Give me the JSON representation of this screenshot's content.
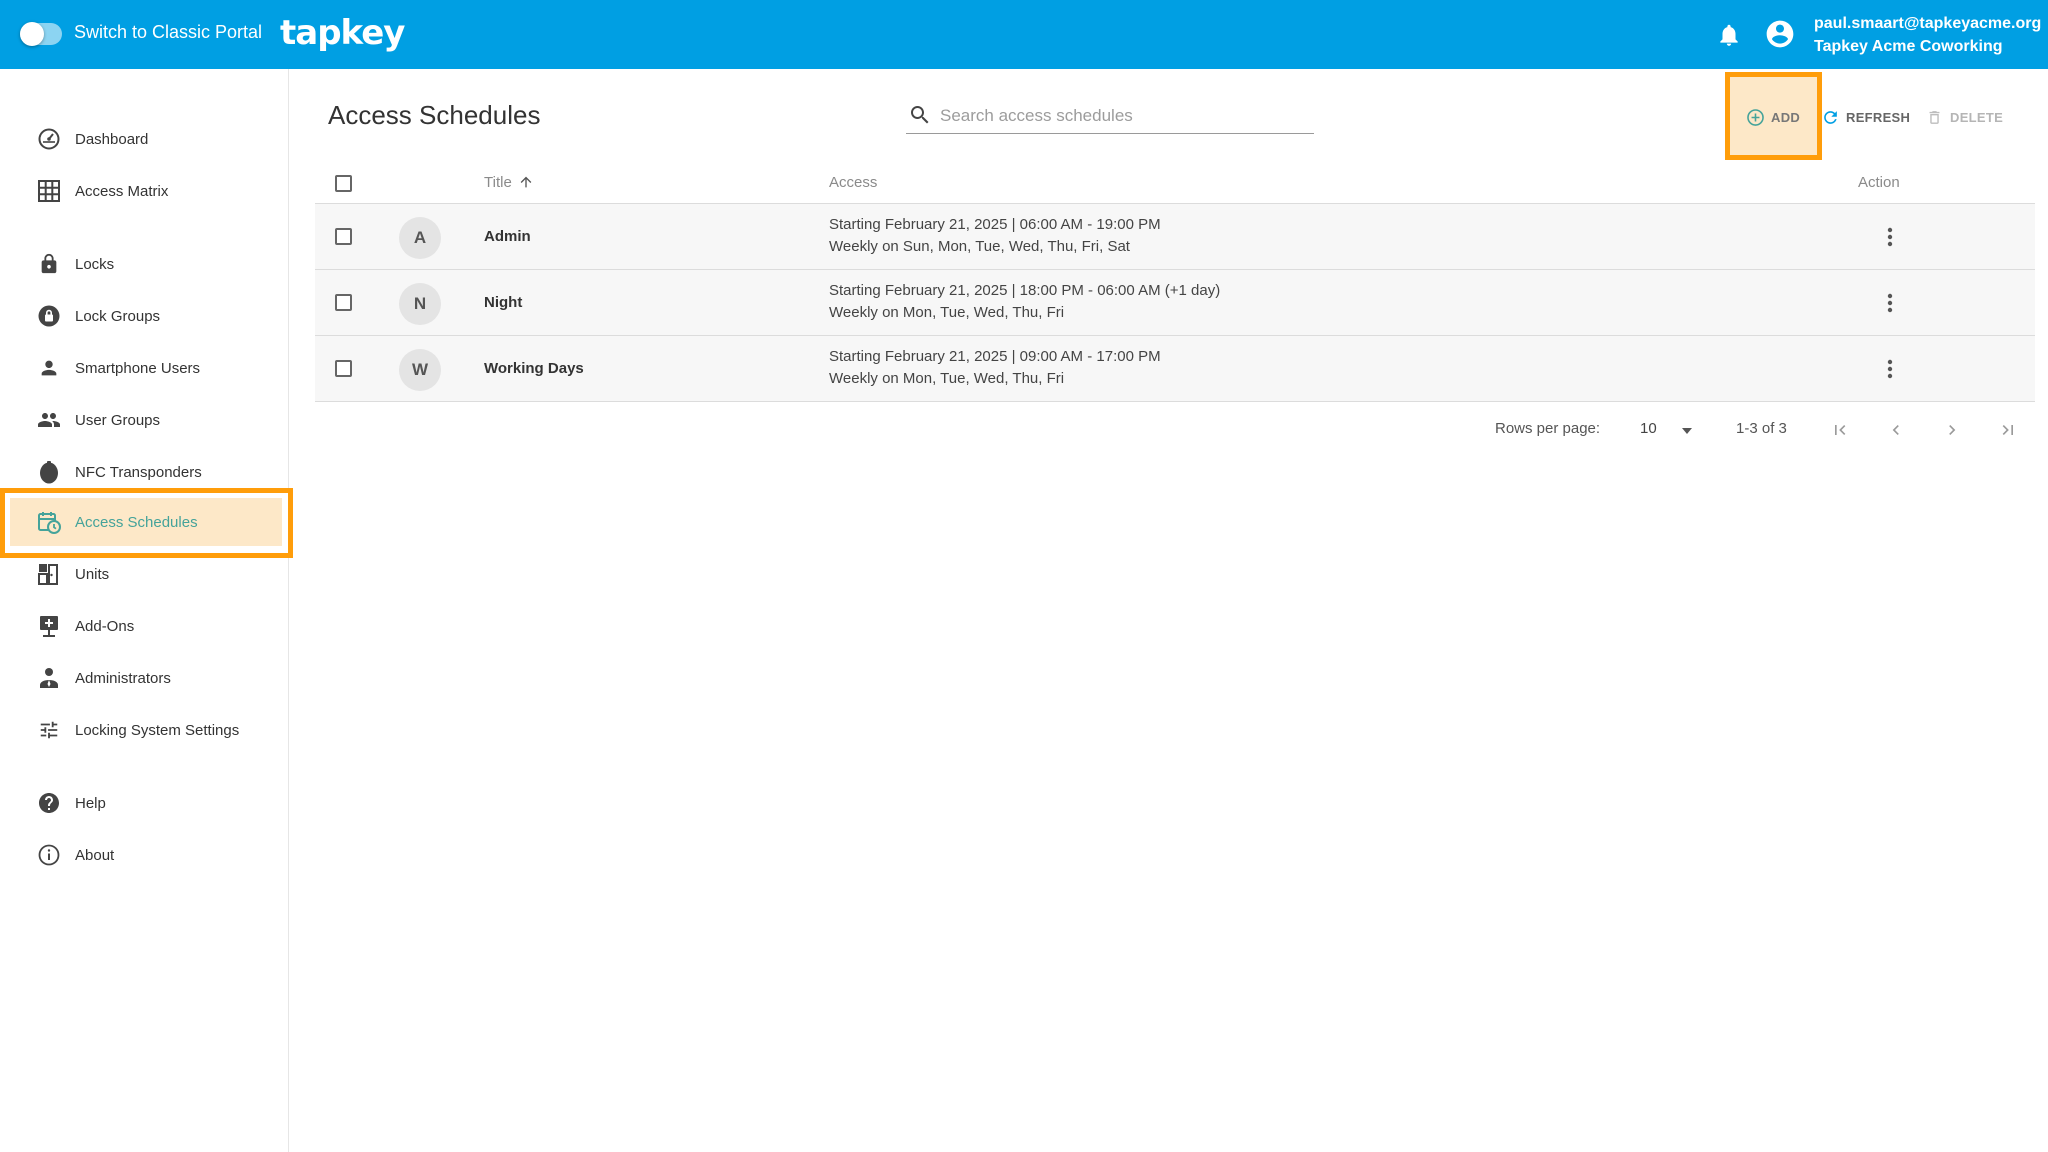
{
  "header": {
    "toggle_label": "Switch to Classic Portal",
    "logo": "tapkey",
    "user_email": "paul.smaart@tapkeyacme.org",
    "user_org": "Tapkey Acme Coworking"
  },
  "sidebar": {
    "items": [
      {
        "label": "Dashboard",
        "icon": "dashboard-icon"
      },
      {
        "label": "Access Matrix",
        "icon": "grid-icon"
      },
      {
        "label": "Locks",
        "icon": "lock-icon"
      },
      {
        "label": "Lock Groups",
        "icon": "lock-group-icon"
      },
      {
        "label": "Smartphone Users",
        "icon": "person-icon"
      },
      {
        "label": "User Groups",
        "icon": "people-icon"
      },
      {
        "label": "NFC Transponders",
        "icon": "transponder-icon"
      },
      {
        "label": "Access Schedules",
        "icon": "calendar-clock-icon"
      },
      {
        "label": "Units",
        "icon": "units-icon"
      },
      {
        "label": "Add-Ons",
        "icon": "add-on-icon"
      },
      {
        "label": "Administrators",
        "icon": "admin-icon"
      },
      {
        "label": "Locking System Settings",
        "icon": "sliders-icon"
      },
      {
        "label": "Help",
        "icon": "help-icon"
      },
      {
        "label": "About",
        "icon": "info-icon"
      }
    ],
    "active": "Access Schedules"
  },
  "main": {
    "title": "Access Schedules",
    "search_placeholder": "Search access schedules",
    "toolbar": {
      "add_label": "ADD",
      "refresh_label": "REFRESH",
      "delete_label": "DELETE"
    },
    "table": {
      "columns": {
        "title": "Title",
        "access": "Access",
        "action": "Action"
      },
      "rows": [
        {
          "initial": "A",
          "title": "Admin",
          "line1": "Starting February 21, 2025 | 06:00 AM - 19:00 PM",
          "line2": "Weekly on Sun, Mon, Tue, Wed, Thu, Fri, Sat"
        },
        {
          "initial": "N",
          "title": "Night",
          "line1": "Starting February 21, 2025 | 18:00 PM - 06:00 AM (+1 day)",
          "line2": "Weekly on Mon, Tue, Wed, Thu, Fri"
        },
        {
          "initial": "W",
          "title": "Working Days",
          "line1": "Starting February 21, 2025 | 09:00 AM - 17:00 PM",
          "line2": "Weekly on Mon, Tue, Wed, Thu, Fri"
        }
      ]
    },
    "pagination": {
      "rows_per_page_label": "Rows per page:",
      "rows_per_page": "10",
      "range": "1-3 of 3"
    }
  },
  "colors": {
    "header_bg": "#009fe3",
    "highlight": "#ff9d0a",
    "active_bg": "#fde8c8",
    "active_text": "#45a39a"
  }
}
